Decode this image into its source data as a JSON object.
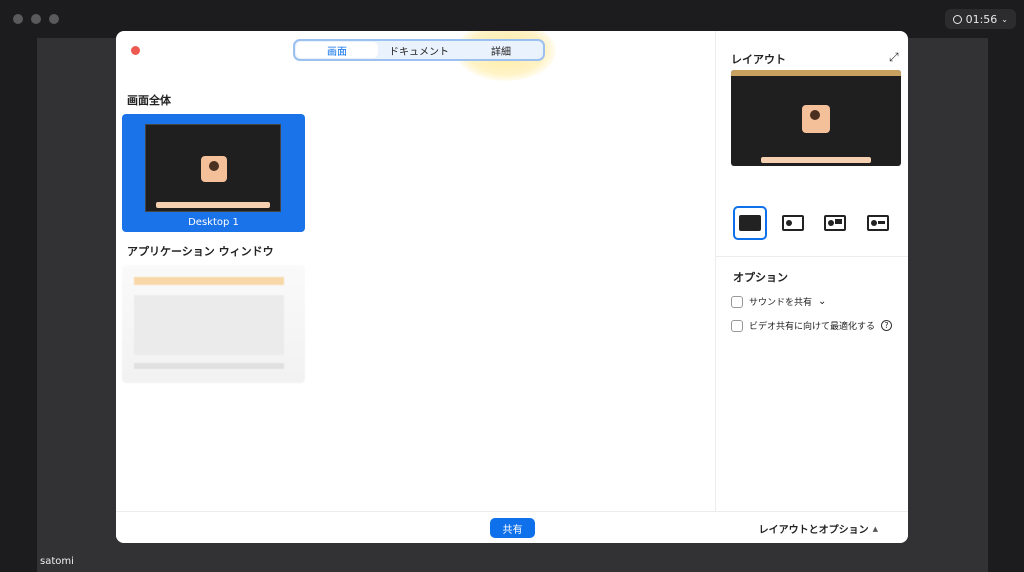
{
  "window": {
    "timer": "01:56",
    "participant_name": "satomi"
  },
  "tabs": [
    {
      "label": "画面",
      "active": true
    },
    {
      "label": "ドキュメント",
      "active": false
    },
    {
      "label": "詳細",
      "active": false
    }
  ],
  "sections": {
    "full_screen_title": "画面全体",
    "desktop_label": "Desktop 1",
    "app_windows_title": "アプリケーション ウィンドウ"
  },
  "right_panel": {
    "layout_title": "レイアウト",
    "options_title": "オプション",
    "option_sound": "サウンドを共有",
    "option_video": "ビデオ共有に向けて最適化する",
    "help_glyph": "?"
  },
  "footer": {
    "share_label": "共有",
    "layout_options_label": "レイアウトとオプション",
    "caret_glyph": "▲"
  },
  "colors": {
    "accent": "#0e71eb",
    "close": "#ee5a52",
    "highlight": "#ffdc5a"
  },
  "icons": {
    "expand": "⤢",
    "chevron": "⌄"
  }
}
